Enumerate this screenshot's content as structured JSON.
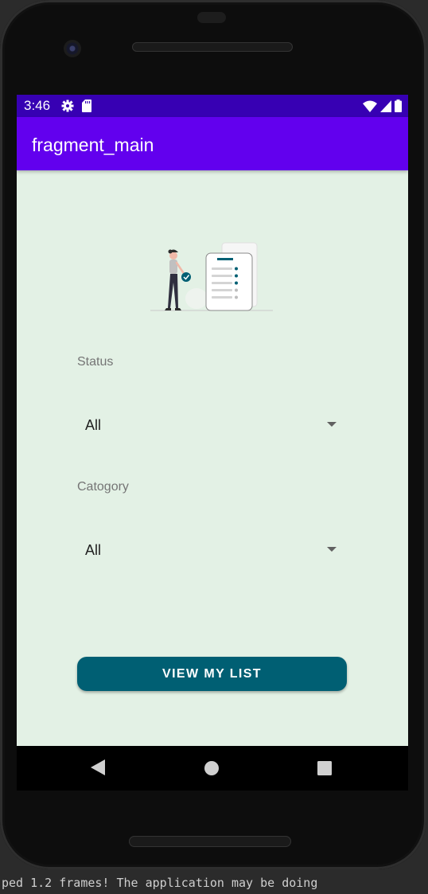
{
  "status_bar": {
    "time": "3:46",
    "icons_left": [
      "gear-icon",
      "sd-card-icon"
    ],
    "icons_right": [
      "wifi-icon",
      "cell-signal-icon",
      "battery-icon"
    ],
    "color": "#3700b3"
  },
  "app_bar": {
    "title": "fragment_main",
    "color": "#6200ee"
  },
  "form": {
    "status": {
      "label": "Status",
      "selected": "All"
    },
    "category": {
      "label": "Catogory",
      "selected": "All"
    },
    "button_label": "VIEW MY LIST",
    "button_color": "#005f73",
    "background": "#e3f1e5"
  },
  "nav_bar": {
    "buttons": [
      "back-icon",
      "home-icon",
      "recents-icon"
    ]
  },
  "ide_console": {
    "text": "ped 1.2 frames!  The application may be doing"
  }
}
